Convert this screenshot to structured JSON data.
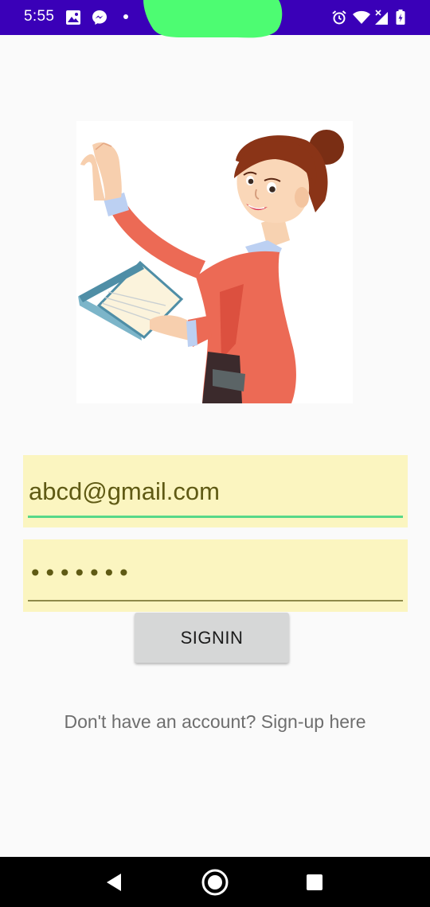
{
  "status_bar": {
    "time": "5:55",
    "background": "#3a00b8",
    "left_icons": [
      "image-icon",
      "messenger-icon",
      "dot-icon"
    ],
    "right_icons": [
      "alarm-icon",
      "wifi-icon",
      "signal-icon",
      "battery-icon"
    ]
  },
  "hero": {
    "icon": "woman-reading-book-illustration"
  },
  "form": {
    "email_value": "abcd@gmail.com",
    "password_value": "•••••••",
    "field_background": "#fbf5c0",
    "focus_color": "#57d888"
  },
  "signin_button": {
    "label": "SIGNIN"
  },
  "signup": {
    "text": "Don't have an account? Sign-up here"
  },
  "nav_bar": {
    "buttons": [
      "back-icon",
      "home-icon",
      "recents-icon"
    ]
  }
}
